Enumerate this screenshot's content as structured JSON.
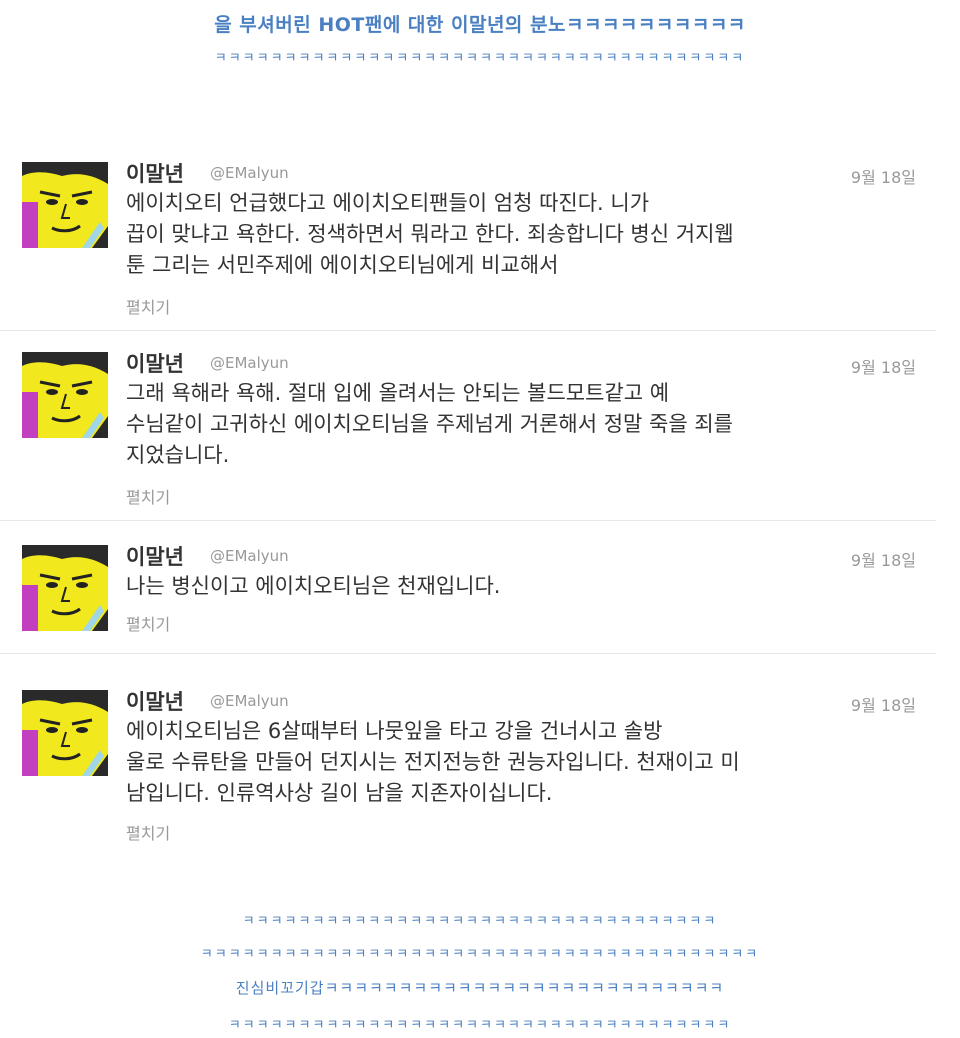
{
  "header": {
    "line1": "을 부셔버린 HOT팬에 대한 이말년의 분노ㅋㅋㅋㅋㅋㅋㅋㅋㅋㅋ",
    "line2": "ㅋㅋㅋㅋㅋㅋㅋㅋㅋㅋㅋㅋㅋㅋㅋㅋㅋㅋㅋㅋㅋㅋㅋㅋㅋㅋㅋㅋㅋㅋㅋㅋㅋㅋㅋㅋㅋㅋ"
  },
  "tweets": [
    {
      "name": "이말년",
      "handle": "@EMalyun",
      "time": "9월 18일",
      "lines": [
        "에이치오티 언급했다고 에이치오티팬들이 엄청 따진다. 니가",
        "끕이 맞냐고 욕한다. 정색하면서 뭐라고 한다. 죄송합니다 병신 거지웹",
        "툰 그리는 서민주제에 에이치오티님에게 비교해서"
      ],
      "expand": "펼치기"
    },
    {
      "name": "이말년",
      "handle": "@EMalyun",
      "time": "9월 18일",
      "lines": [
        "그래 욕해라 욕해. 절대 입에 올려서는 안되는 볼드모트같고 예",
        "수님같이 고귀하신 에이치오티님을 주제넘게 거론해서 정말 죽을 죄를",
        "지었습니다."
      ],
      "expand": "펼치기"
    },
    {
      "name": "이말년",
      "handle": "@EMalyun",
      "time": "9월 18일",
      "lines": [
        "나는 병신이고 에이치오티님은 천재입니다."
      ],
      "expand": "펼치기"
    },
    {
      "name": "이말년",
      "handle": "@EMalyun",
      "time": "9월 18일",
      "lines": [
        "에이치오티님은 6살때부터 나뭇잎을 타고 강을 건너시고 솔방",
        "울로 수류탄을 만들어 던지시는 전지전능한 권능자입니다. 천재이고 미",
        "남입니다. 인류역사상 길이 남을 지존자이십니다."
      ],
      "expand": "펼치기"
    }
  ],
  "footer": {
    "line1": "ㅋㅋㅋㅋㅋㅋㅋㅋㅋㅋㅋㅋㅋㅋㅋㅋㅋㅋㅋㅋㅋㅋㅋㅋㅋㅋㅋㅋㅋㅋㅋㅋㅋㅋ",
    "line2": "ㅋㅋㅋㅋㅋㅋㅋㅋㅋㅋㅋㅋㅋㅋㅋㅋㅋㅋㅋㅋㅋㅋㅋㅋㅋㅋㅋㅋㅋㅋㅋㅋㅋㅋㅋㅋㅋㅋㅋㅋ",
    "line3": "진심비꼬기갑ㅋㅋㅋㅋㅋㅋㅋㅋㅋㅋㅋㅋㅋㅋㅋㅋㅋㅋㅋㅋㅋㅋㅋㅋㅋㅋㅋ",
    "line4": "ㅋㅋㅋㅋㅋㅋㅋㅋㅋㅋㅋㅋㅋㅋㅋㅋㅋㅋㅋㅋㅋㅋㅋㅋㅋㅋㅋㅋㅋㅋㅋㅋㅋㅋㅋㅋ"
  },
  "colors": {
    "caption": "#4a7fc1",
    "name": "#333333",
    "meta": "#999999",
    "avatar_face": "#f2e81e",
    "avatar_side": "#c23fbf"
  },
  "icons": {
    "avatar": "cartoon-face-avatar"
  }
}
